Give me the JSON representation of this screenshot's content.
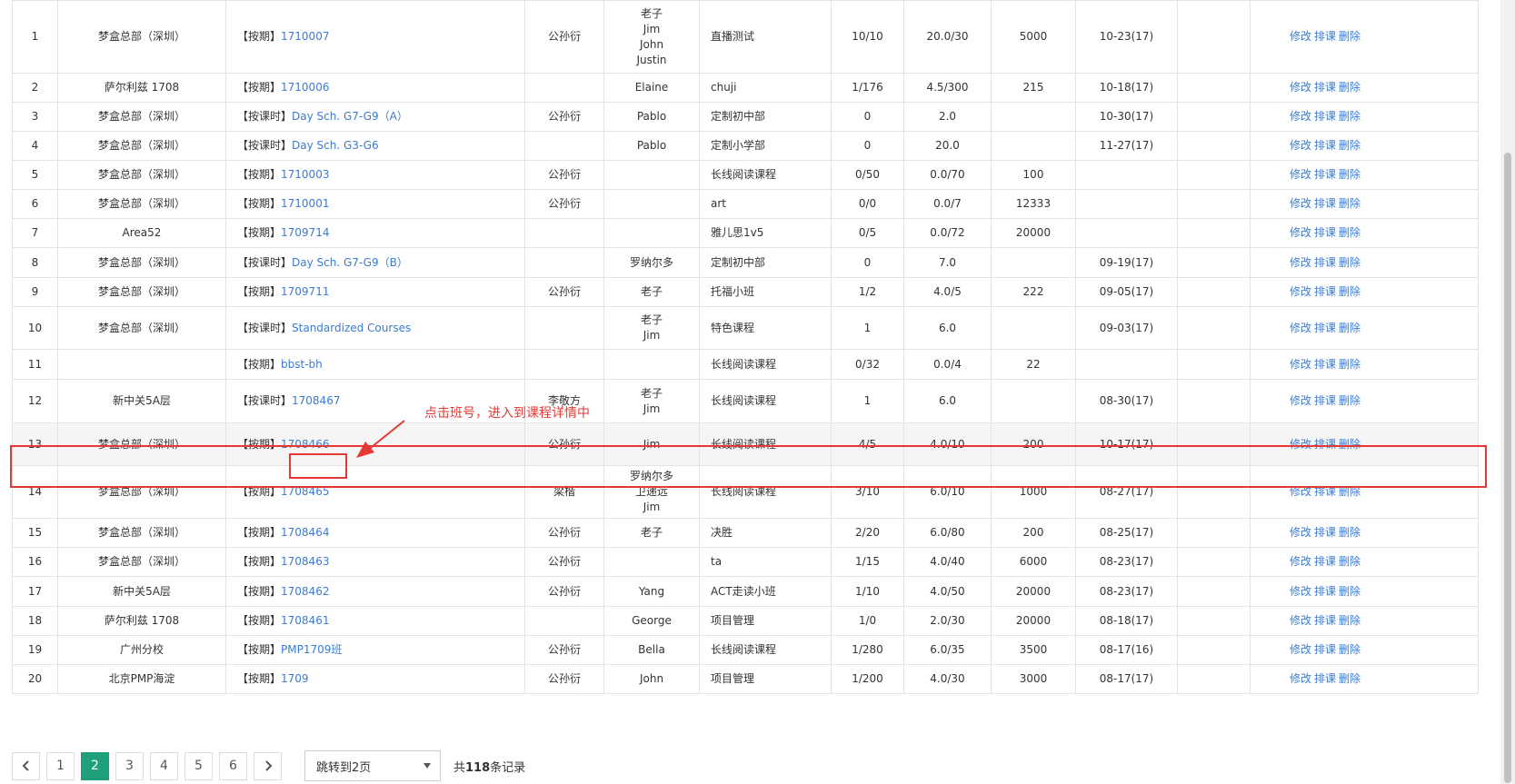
{
  "rows": [
    {
      "no": "1",
      "branch": "梦盒总部（深圳）",
      "type": "【按期】",
      "course": "1710007",
      "staff": "公孙衍",
      "teachers": [
        "老子",
        "Jim",
        "John",
        "Justin"
      ],
      "product": "直播测试",
      "students": "10/10",
      "hours": "20.0/30",
      "price": "5000",
      "start": "10-23(17)"
    },
    {
      "no": "2",
      "branch": "萨尔利兹 1708",
      "type": "【按期】",
      "course": "1710006",
      "staff": "",
      "teachers": [
        "Elaine"
      ],
      "product": "chuji",
      "students": "1/176",
      "hours": "4.5/300",
      "price": "215",
      "start": "10-18(17)"
    },
    {
      "no": "3",
      "branch": "梦盒总部（深圳）",
      "type": "【按课时】",
      "course": "Day Sch. G7-G9（A）",
      "staff": "公孙衍",
      "teachers": [
        "Pablo"
      ],
      "product": "定制初中部",
      "students": "0",
      "hours": "2.0",
      "price": "",
      "start": "10-30(17)"
    },
    {
      "no": "4",
      "branch": "梦盒总部（深圳）",
      "type": "【按课时】",
      "course": "Day Sch. G3-G6",
      "staff": "",
      "teachers": [
        "Pablo"
      ],
      "product": "定制小学部",
      "students": "0",
      "hours": "20.0",
      "price": "",
      "start": "11-27(17)"
    },
    {
      "no": "5",
      "branch": "梦盒总部（深圳）",
      "type": "【按期】",
      "course": "1710003",
      "staff": "公孙衍",
      "teachers": [],
      "product": "长线阅读课程",
      "students": "0/50",
      "hours": "0.0/70",
      "price": "100",
      "start": ""
    },
    {
      "no": "6",
      "branch": "梦盒总部（深圳）",
      "type": "【按期】",
      "course": "1710001",
      "staff": "公孙衍",
      "teachers": [],
      "product": "art",
      "students": "0/0",
      "hours": "0.0/7",
      "price": "12333",
      "start": ""
    },
    {
      "no": "7",
      "branch": "Area52",
      "type": "【按期】",
      "course": "1709714",
      "staff": "",
      "teachers": [],
      "product": "雅儿思1v5",
      "students": "0/5",
      "hours": "0.0/72",
      "price": "20000",
      "start": ""
    },
    {
      "no": "8",
      "branch": "梦盒总部（深圳）",
      "type": "【按课时】",
      "course": "Day Sch. G7-G9（B）",
      "staff": "",
      "teachers": [
        "罗纳尔多"
      ],
      "product": "定制初中部",
      "students": "0",
      "hours": "7.0",
      "price": "",
      "start": "09-19(17)"
    },
    {
      "no": "9",
      "branch": "梦盒总部（深圳）",
      "type": "【按期】",
      "course": "1709711",
      "staff": "公孙衍",
      "teachers": [
        "老子"
      ],
      "product": "托福小班",
      "students": "1/2",
      "hours": "4.0/5",
      "price": "222",
      "start": "09-05(17)"
    },
    {
      "no": "10",
      "branch": "梦盒总部（深圳）",
      "type": "【按课时】",
      "course": "Standardized Courses",
      "staff": "",
      "teachers": [
        "老子",
        "Jim"
      ],
      "product": "特色课程",
      "students": "1",
      "hours": "6.0",
      "price": "",
      "start": "09-03(17)"
    },
    {
      "no": "11",
      "branch": "",
      "type": "【按期】",
      "course": "bbst-bh",
      "staff": "",
      "teachers": [],
      "product": "长线阅读课程",
      "students": "0/32",
      "hours": "0.0/4",
      "price": "22",
      "start": ""
    },
    {
      "no": "12",
      "branch": "新中关5A层",
      "type": "【按课时】",
      "course": "1708467",
      "staff": "李敬方",
      "teachers": [
        "老子",
        "Jim"
      ],
      "product": "长线阅读课程",
      "students": "1",
      "hours": "6.0",
      "price": "",
      "start": "08-30(17)"
    },
    {
      "no": "13",
      "branch": "梦盒总部（深圳）",
      "type": "【按期】",
      "course": "1708466",
      "staff": "公孙衍",
      "teachers": [
        "Jim"
      ],
      "product": "长线阅读课程",
      "students": "4/5",
      "hours": "4.0/10",
      "price": "200",
      "start": "10-17(17)"
    },
    {
      "no": "14",
      "branch": "梦盒总部（深圳）",
      "type": "【按期】",
      "course": "1708465",
      "staff": "梁楷",
      "teachers": [
        "罗纳尔多",
        "卫递远",
        "Jim"
      ],
      "product": "长线阅读课程",
      "students": "3/10",
      "hours": "6.0/10",
      "price": "1000",
      "start": "08-27(17)"
    },
    {
      "no": "15",
      "branch": "梦盒总部（深圳）",
      "type": "【按期】",
      "course": "1708464",
      "staff": "公孙衍",
      "teachers": [
        "老子"
      ],
      "product": "决胜",
      "students": "2/20",
      "hours": "6.0/80",
      "price": "200",
      "start": "08-25(17)"
    },
    {
      "no": "16",
      "branch": "梦盒总部（深圳）",
      "type": "【按期】",
      "course": "1708463",
      "staff": "公孙衍",
      "teachers": [],
      "product": "ta",
      "students": "1/15",
      "hours": "4.0/40",
      "price": "6000",
      "start": "08-23(17)"
    },
    {
      "no": "17",
      "branch": "新中关5A层",
      "type": "【按期】",
      "course": "1708462",
      "staff": "公孙衍",
      "teachers": [
        "Yang"
      ],
      "product": "ACT走读小班",
      "students": "1/10",
      "hours": "4.0/50",
      "price": "20000",
      "start": "08-23(17)"
    },
    {
      "no": "18",
      "branch": "萨尔利兹 1708",
      "type": "【按期】",
      "course": "1708461",
      "staff": "",
      "teachers": [
        "George"
      ],
      "product": "项目管理",
      "students": "1/0",
      "hours": "2.0/30",
      "price": "20000",
      "start": "08-18(17)"
    },
    {
      "no": "19",
      "branch": "广州分校",
      "type": "【按期】",
      "course": "PMP1709班",
      "staff": "公孙衍",
      "teachers": [
        "Bella"
      ],
      "product": "长线阅读课程",
      "students": "1/280",
      "hours": "6.0/35",
      "price": "3500",
      "start": "08-17(16)"
    },
    {
      "no": "20",
      "branch": "北京PMP海淀",
      "type": "【按期】",
      "course": "1709",
      "staff": "公孙衍",
      "teachers": [
        "John"
      ],
      "product": "项目管理",
      "students": "1/200",
      "hours": "4.0/30",
      "price": "3000",
      "start": "08-17(17)"
    }
  ],
  "ops": {
    "edit": "修改",
    "schedule": "排课",
    "delete": "删除"
  },
  "annotation": "点击班号，进入到课程详情中",
  "pager": {
    "pages": [
      "1",
      "2",
      "3",
      "4",
      "5",
      "6"
    ],
    "active": "2",
    "jump_label": "跳转到2页",
    "total_prefix": "共",
    "total_count": "118",
    "total_suffix": "条记录"
  },
  "colors": {
    "link": "#3a7bd5",
    "annotation": "#e53935",
    "active_page": "#1fa07a"
  }
}
